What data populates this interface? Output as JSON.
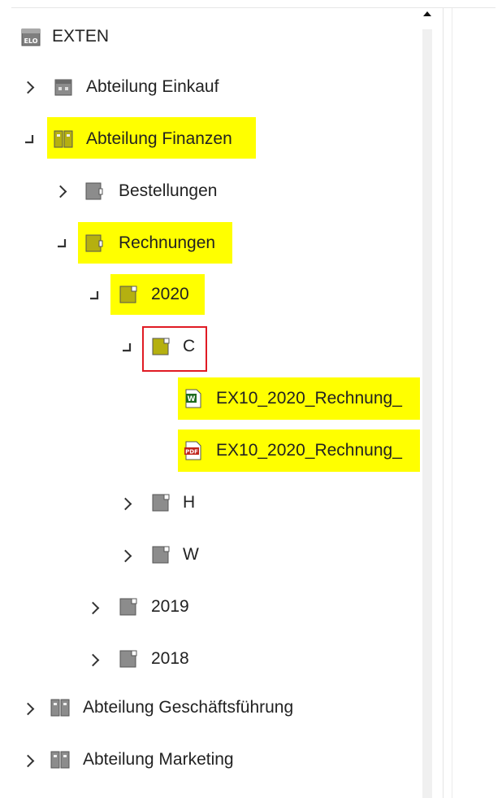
{
  "tree": {
    "root": {
      "label": "EXTEN",
      "icon": "elo-archive-icon"
    },
    "abteilung_einkauf": {
      "label": "Abteilung Einkauf",
      "icon": "cabinet-icon"
    },
    "abteilung_finanzen": {
      "label": "Abteilung Finanzen",
      "icon": "binder-icon"
    },
    "bestellungen": {
      "label": "Bestellungen",
      "icon": "register-icon"
    },
    "rechnungen": {
      "label": "Rechnungen",
      "icon": "register-icon"
    },
    "f2020": {
      "label": "2020",
      "icon": "folder-icon"
    },
    "c": {
      "label": "C",
      "icon": "folder-icon"
    },
    "doc_word": {
      "label": "EX10_2020_Rechnung_",
      "icon": "word-document-icon"
    },
    "doc_pdf": {
      "label": "EX10_2020_Rechnung_",
      "icon": "pdf-document-icon"
    },
    "h": {
      "label": "H",
      "icon": "folder-icon"
    },
    "w": {
      "label": "W",
      "icon": "folder-icon"
    },
    "f2019": {
      "label": "2019",
      "icon": "folder-icon"
    },
    "f2018": {
      "label": "2018",
      "icon": "folder-icon"
    },
    "abteilung_gf": {
      "label": "Abteilung Geschäftsführung",
      "icon": "binder-icon"
    },
    "abteilung_marketing": {
      "label": "Abteilung Marketing",
      "icon": "binder-icon"
    }
  },
  "colors": {
    "highlight": "#ffff00",
    "selection_border": "#e01b24",
    "active_icon": "#b5b010",
    "inactive_icon": "#8c8c8c"
  }
}
